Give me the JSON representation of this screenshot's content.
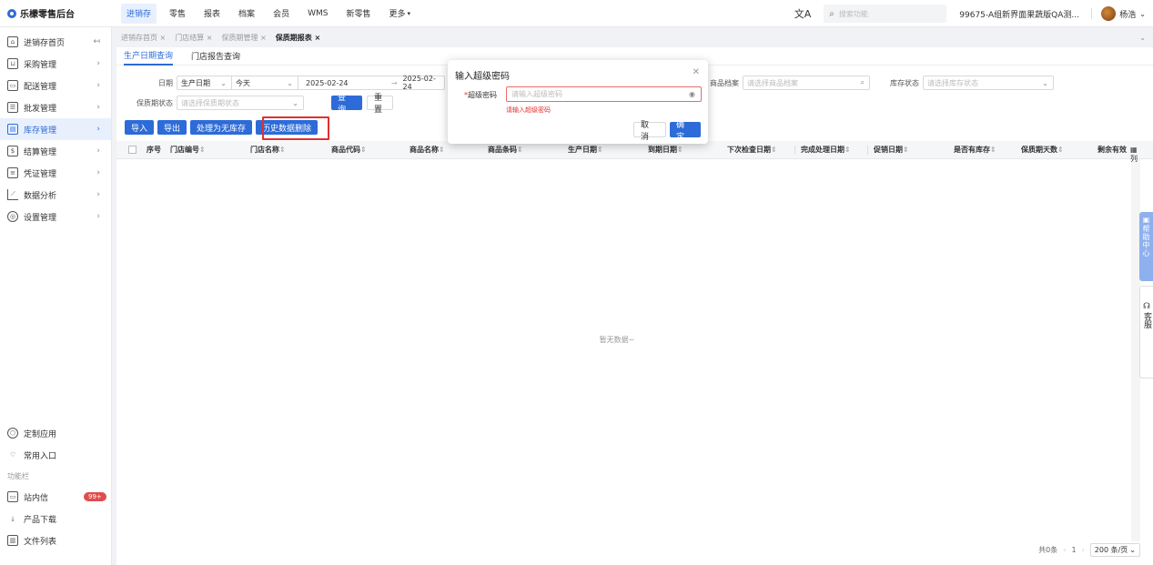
{
  "app": {
    "brand": "乐檬零售后台"
  },
  "topnav": [
    "进销存",
    "零售",
    "报表",
    "档案",
    "会员",
    "WMS",
    "新零售",
    "更多"
  ],
  "header": {
    "search_placeholder": "搜索功能",
    "org": "99675-A组新界面果蔬版QA测...",
    "user": "杨浩"
  },
  "sidebar": {
    "items": [
      {
        "label": "进销存首页",
        "icon": "home-icon",
        "arrow": "↤"
      },
      {
        "label": "采购管理",
        "icon": "cart-icon",
        "arrow": "›"
      },
      {
        "label": "配送管理",
        "icon": "truck-icon",
        "arrow": "›"
      },
      {
        "label": "批发管理",
        "icon": "wholesale-icon",
        "arrow": "›"
      },
      {
        "label": "库存管理",
        "icon": "inventory-icon",
        "arrow": "›",
        "active": true
      },
      {
        "label": "结算管理",
        "icon": "settlement-icon",
        "arrow": "›"
      },
      {
        "label": "凭证管理",
        "icon": "voucher-icon",
        "arrow": "›"
      },
      {
        "label": "数据分析",
        "icon": "chart-icon",
        "arrow": "›"
      },
      {
        "label": "设置管理",
        "icon": "settings-icon",
        "arrow": "›"
      }
    ],
    "bottom": {
      "custom_app": "定制应用",
      "common_entry": "常用入口",
      "section_label": "功能栏",
      "messages": "站内信",
      "messages_badge": "99+",
      "download": "产品下载",
      "file_list": "文件列表"
    }
  },
  "tabs": [
    "进销存首页 ×",
    "门店结算 ×",
    "保质期管理 ×",
    "保质期报表 ×"
  ],
  "subtabs": [
    "生产日期查询",
    "门店报告查询"
  ],
  "filters": {
    "date_label": "日期",
    "date_type": "生产日期",
    "date_preset": "今天",
    "date_start": "2025-02-24",
    "date_sep": "→",
    "date_end": "2025-02-24",
    "product_label": "商品档案",
    "product_placeholder": "请选择商品档案",
    "stock_label": "库存状态",
    "stock_placeholder": "请选择库存状态",
    "shelf_label": "保质期状态",
    "shelf_placeholder": "请选择保质期状态",
    "query_btn": "查 询",
    "reset_btn": "重 置"
  },
  "actions": [
    "导入",
    "导出",
    "处理为无库存",
    "历史数据删除"
  ],
  "table": {
    "columns": [
      "序号",
      "门店编号",
      "门店名称",
      "商品代码",
      "商品名称",
      "商品条码",
      "生产日期",
      "到期日期",
      "下次检查日期",
      "完成处理日期",
      "促销日期",
      "是否有库存",
      "保质期天数",
      "剩余有效"
    ],
    "empty": "暂无数据~",
    "column_toggle": "列"
  },
  "pager": {
    "total": "共0条",
    "page": "1",
    "size": "200 条/页"
  },
  "widgets": {
    "help": "帮助中心",
    "service": "客服"
  },
  "modal": {
    "title": "输入超级密码",
    "field_label": "超级密码",
    "placeholder": "请输入超级密码",
    "error": "请输入超级密码",
    "cancel": "取 消",
    "ok": "确 定"
  },
  "colors": {
    "primary": "#2d6bd8",
    "danger": "#e23030"
  }
}
